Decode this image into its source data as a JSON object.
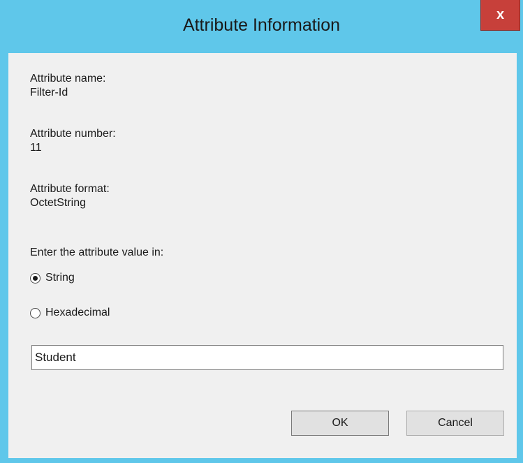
{
  "window": {
    "title": "Attribute Information",
    "close_glyph": "x"
  },
  "fields": {
    "name_label": "Attribute name:",
    "name_value": "Filter-Id",
    "number_label": "Attribute number:",
    "number_value": "11",
    "format_label": "Attribute format:",
    "format_value": "OctetString"
  },
  "value_format": {
    "prompt": "Enter the attribute value in:",
    "options": [
      {
        "label": "String",
        "selected": true
      },
      {
        "label": "Hexadecimal",
        "selected": false
      }
    ]
  },
  "input": {
    "value": "Student"
  },
  "buttons": {
    "ok": "OK",
    "cancel": "Cancel"
  },
  "colors": {
    "frame": "#5fc7ea",
    "close_button": "#c7403a",
    "client_bg": "#f0f0f0"
  }
}
